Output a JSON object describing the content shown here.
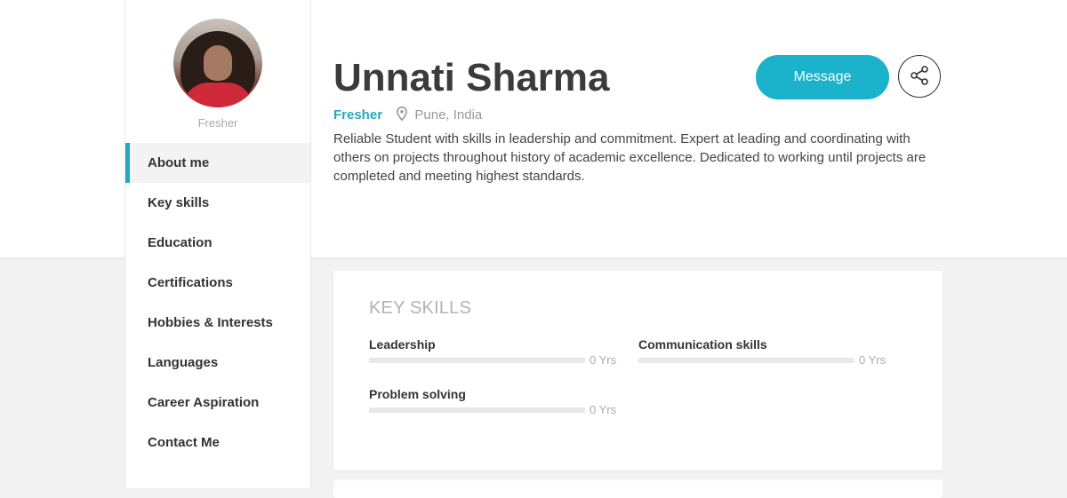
{
  "profile": {
    "name": "Unnati Sharma",
    "caption": "Fresher",
    "status": "Fresher",
    "location": "Pune, India",
    "bio": "Reliable Student with skills in leadership and commitment. Expert at leading and coordinating with others on projects throughout history of academic excellence. Dedicated to working until projects are completed and meeting highest standards.",
    "avatar_icon": "user-photo"
  },
  "nav": {
    "items": [
      {
        "label": "About me",
        "active": true
      },
      {
        "label": "Key skills"
      },
      {
        "label": "Education"
      },
      {
        "label": "Certifications"
      },
      {
        "label": "Hobbies & Interests"
      },
      {
        "label": "Languages"
      },
      {
        "label": "Career Aspiration"
      },
      {
        "label": "Contact Me"
      }
    ]
  },
  "actions": {
    "message_label": "Message",
    "share_icon": "share-icon"
  },
  "key_skills": {
    "title": "KEY SKILLS",
    "skills": [
      {
        "name": "Leadership",
        "years": "0 Yrs",
        "level": 0
      },
      {
        "name": "Communication skills",
        "years": "0 Yrs",
        "level": 0
      },
      {
        "name": "Problem solving",
        "years": "0 Yrs",
        "level": 0
      }
    ]
  },
  "colors": {
    "accent": "#26a6c1",
    "message_button": "#1ab3cb",
    "background": "#f2f2f2"
  }
}
